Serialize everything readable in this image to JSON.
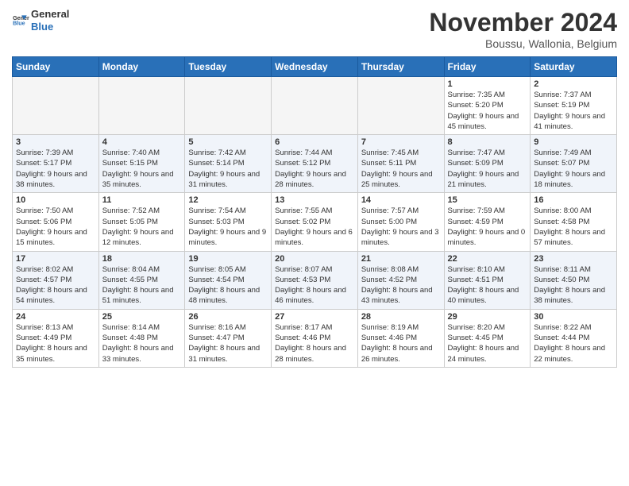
{
  "header": {
    "logo_line1": "General",
    "logo_line2": "Blue",
    "month": "November 2024",
    "location": "Boussu, Wallonia, Belgium"
  },
  "weekdays": [
    "Sunday",
    "Monday",
    "Tuesday",
    "Wednesday",
    "Thursday",
    "Friday",
    "Saturday"
  ],
  "weeks": [
    [
      {
        "day": "",
        "info": ""
      },
      {
        "day": "",
        "info": ""
      },
      {
        "day": "",
        "info": ""
      },
      {
        "day": "",
        "info": ""
      },
      {
        "day": "",
        "info": ""
      },
      {
        "day": "1",
        "info": "Sunrise: 7:35 AM\nSunset: 5:20 PM\nDaylight: 9 hours and 45 minutes."
      },
      {
        "day": "2",
        "info": "Sunrise: 7:37 AM\nSunset: 5:19 PM\nDaylight: 9 hours and 41 minutes."
      }
    ],
    [
      {
        "day": "3",
        "info": "Sunrise: 7:39 AM\nSunset: 5:17 PM\nDaylight: 9 hours and 38 minutes."
      },
      {
        "day": "4",
        "info": "Sunrise: 7:40 AM\nSunset: 5:15 PM\nDaylight: 9 hours and 35 minutes."
      },
      {
        "day": "5",
        "info": "Sunrise: 7:42 AM\nSunset: 5:14 PM\nDaylight: 9 hours and 31 minutes."
      },
      {
        "day": "6",
        "info": "Sunrise: 7:44 AM\nSunset: 5:12 PM\nDaylight: 9 hours and 28 minutes."
      },
      {
        "day": "7",
        "info": "Sunrise: 7:45 AM\nSunset: 5:11 PM\nDaylight: 9 hours and 25 minutes."
      },
      {
        "day": "8",
        "info": "Sunrise: 7:47 AM\nSunset: 5:09 PM\nDaylight: 9 hours and 21 minutes."
      },
      {
        "day": "9",
        "info": "Sunrise: 7:49 AM\nSunset: 5:07 PM\nDaylight: 9 hours and 18 minutes."
      }
    ],
    [
      {
        "day": "10",
        "info": "Sunrise: 7:50 AM\nSunset: 5:06 PM\nDaylight: 9 hours and 15 minutes."
      },
      {
        "day": "11",
        "info": "Sunrise: 7:52 AM\nSunset: 5:05 PM\nDaylight: 9 hours and 12 minutes."
      },
      {
        "day": "12",
        "info": "Sunrise: 7:54 AM\nSunset: 5:03 PM\nDaylight: 9 hours and 9 minutes."
      },
      {
        "day": "13",
        "info": "Sunrise: 7:55 AM\nSunset: 5:02 PM\nDaylight: 9 hours and 6 minutes."
      },
      {
        "day": "14",
        "info": "Sunrise: 7:57 AM\nSunset: 5:00 PM\nDaylight: 9 hours and 3 minutes."
      },
      {
        "day": "15",
        "info": "Sunrise: 7:59 AM\nSunset: 4:59 PM\nDaylight: 9 hours and 0 minutes."
      },
      {
        "day": "16",
        "info": "Sunrise: 8:00 AM\nSunset: 4:58 PM\nDaylight: 8 hours and 57 minutes."
      }
    ],
    [
      {
        "day": "17",
        "info": "Sunrise: 8:02 AM\nSunset: 4:57 PM\nDaylight: 8 hours and 54 minutes."
      },
      {
        "day": "18",
        "info": "Sunrise: 8:04 AM\nSunset: 4:55 PM\nDaylight: 8 hours and 51 minutes."
      },
      {
        "day": "19",
        "info": "Sunrise: 8:05 AM\nSunset: 4:54 PM\nDaylight: 8 hours and 48 minutes."
      },
      {
        "day": "20",
        "info": "Sunrise: 8:07 AM\nSunset: 4:53 PM\nDaylight: 8 hours and 46 minutes."
      },
      {
        "day": "21",
        "info": "Sunrise: 8:08 AM\nSunset: 4:52 PM\nDaylight: 8 hours and 43 minutes."
      },
      {
        "day": "22",
        "info": "Sunrise: 8:10 AM\nSunset: 4:51 PM\nDaylight: 8 hours and 40 minutes."
      },
      {
        "day": "23",
        "info": "Sunrise: 8:11 AM\nSunset: 4:50 PM\nDaylight: 8 hours and 38 minutes."
      }
    ],
    [
      {
        "day": "24",
        "info": "Sunrise: 8:13 AM\nSunset: 4:49 PM\nDaylight: 8 hours and 35 minutes."
      },
      {
        "day": "25",
        "info": "Sunrise: 8:14 AM\nSunset: 4:48 PM\nDaylight: 8 hours and 33 minutes."
      },
      {
        "day": "26",
        "info": "Sunrise: 8:16 AM\nSunset: 4:47 PM\nDaylight: 8 hours and 31 minutes."
      },
      {
        "day": "27",
        "info": "Sunrise: 8:17 AM\nSunset: 4:46 PM\nDaylight: 8 hours and 28 minutes."
      },
      {
        "day": "28",
        "info": "Sunrise: 8:19 AM\nSunset: 4:46 PM\nDaylight: 8 hours and 26 minutes."
      },
      {
        "day": "29",
        "info": "Sunrise: 8:20 AM\nSunset: 4:45 PM\nDaylight: 8 hours and 24 minutes."
      },
      {
        "day": "30",
        "info": "Sunrise: 8:22 AM\nSunset: 4:44 PM\nDaylight: 8 hours and 22 minutes."
      }
    ]
  ]
}
